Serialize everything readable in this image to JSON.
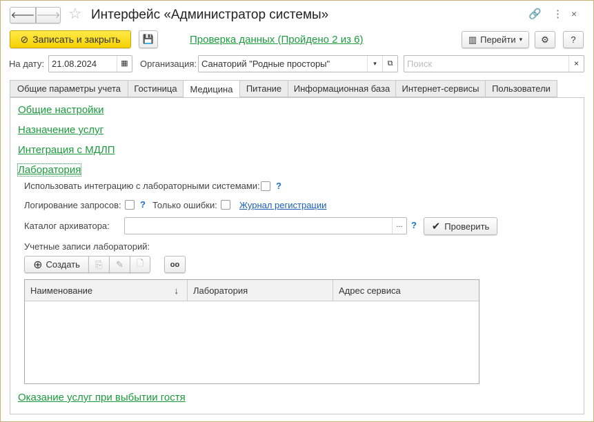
{
  "title": "Интерфейс «Администратор системы»",
  "toolbar": {
    "save_close": "Записать и закрыть",
    "check_link": "Проверка данных (Пройдено 2 из 6)",
    "goto": "Перейти",
    "help": "?"
  },
  "filters": {
    "date_label": "На дату:",
    "date_value": "21.08.2024",
    "org_label": "Организация:",
    "org_value": "Санаторий \"Родные просторы\"",
    "search_placeholder": "Поиск"
  },
  "tabs": [
    "Общие параметры учета",
    "Гостиница",
    "Медицина",
    "Питание",
    "Информационная база",
    "Интернет-сервисы",
    "Пользователи"
  ],
  "sections": {
    "general": "Общие настройки",
    "services": "Назначение услуг",
    "mdlp": "Интеграция с МДЛП",
    "lab": "Лаборатория",
    "departure": "Оказание услуг при выбытии гостя"
  },
  "lab": {
    "use_integration": "Использовать интеграцию с лабораторными системами:",
    "logging": "Логирование запросов:",
    "errors_only": "Только ошибки:",
    "journal": "Журнал регистрации",
    "archiver": "Каталог архиватора:",
    "archiver_btn": "...",
    "check": "Проверить",
    "accounts": "Учетные записи лабораторий:",
    "create": "Создать",
    "q": "?"
  },
  "table": {
    "columns": [
      "Наименование",
      "Лаборатория",
      "Адрес сервиса"
    ],
    "sort": "↓"
  }
}
